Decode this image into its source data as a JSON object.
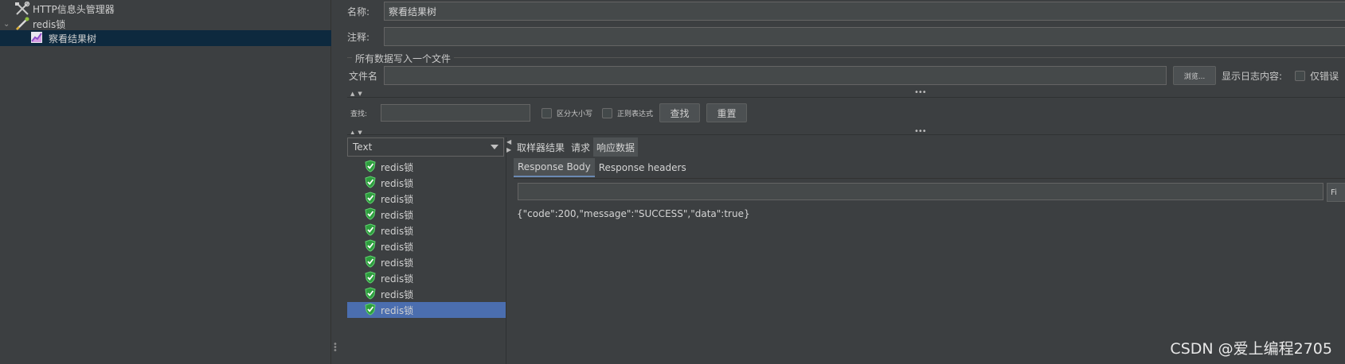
{
  "tree": {
    "items": [
      {
        "label": "HTTP信息头管理器",
        "icon": "wrench-cross-icon"
      },
      {
        "label": "redis锁",
        "icon": "pipette-icon"
      },
      {
        "label": "察看结果树",
        "icon": "chart-icon"
      }
    ]
  },
  "form": {
    "name_label": "名称:",
    "name_value": "察看结果树",
    "comment_label": "注释:",
    "comment_value": "",
    "group_title": "所有数据写入一个文件",
    "file_label": "文件名",
    "file_value": "",
    "browse_label": "浏览...",
    "log_label": "显示日志内容:",
    "errors_only_label": "仅错误"
  },
  "search": {
    "label": "查找:",
    "value": "",
    "case_label": "区分大小写",
    "regex_label": "正则表达式",
    "find_button": "查找",
    "reset_button": "重置"
  },
  "results": {
    "renderer": "Text",
    "items": [
      "redis锁",
      "redis锁",
      "redis锁",
      "redis锁",
      "redis锁",
      "redis锁",
      "redis锁",
      "redis锁",
      "redis锁",
      "redis锁"
    ],
    "selected_index": 9
  },
  "tabs": [
    {
      "label": "取样器结果",
      "active": false
    },
    {
      "label": "请求",
      "active": false
    },
    {
      "label": "响应数据",
      "active": true
    }
  ],
  "subtabs": [
    {
      "label": "Response Body",
      "active": true
    },
    {
      "label": "Response headers",
      "active": false
    }
  ],
  "response": {
    "find_value": "",
    "find_button": "Fi",
    "body": "{\"code\":200,\"message\":\"SUCCESS\",\"data\":true}"
  },
  "watermark": "CSDN @爱上编程2705",
  "colors": {
    "background": "#3c3f41",
    "tree_selection": "#0d293e",
    "list_selection": "#4b6eaf",
    "success": "#3fb950"
  }
}
